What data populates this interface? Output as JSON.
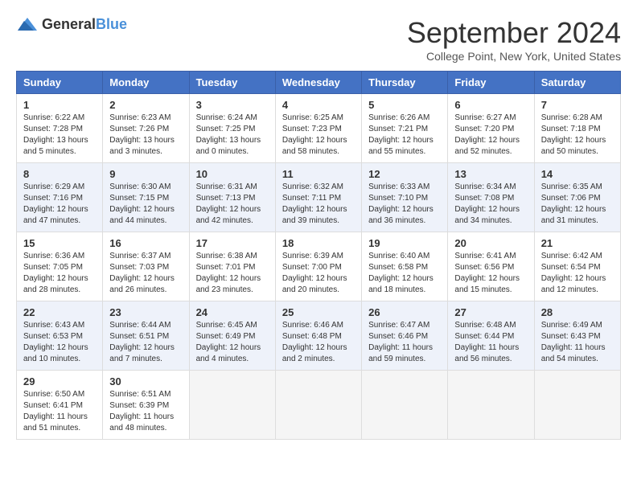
{
  "logo": {
    "general": "General",
    "blue": "Blue"
  },
  "title": "September 2024",
  "location": "College Point, New York, United States",
  "days_of_week": [
    "Sunday",
    "Monday",
    "Tuesday",
    "Wednesday",
    "Thursday",
    "Friday",
    "Saturday"
  ],
  "weeks": [
    [
      {
        "day": "1",
        "sunrise": "6:22 AM",
        "sunset": "7:28 PM",
        "daylight": "13 hours and 5 minutes."
      },
      {
        "day": "2",
        "sunrise": "6:23 AM",
        "sunset": "7:26 PM",
        "daylight": "13 hours and 3 minutes."
      },
      {
        "day": "3",
        "sunrise": "6:24 AM",
        "sunset": "7:25 PM",
        "daylight": "13 hours and 0 minutes."
      },
      {
        "day": "4",
        "sunrise": "6:25 AM",
        "sunset": "7:23 PM",
        "daylight": "12 hours and 58 minutes."
      },
      {
        "day": "5",
        "sunrise": "6:26 AM",
        "sunset": "7:21 PM",
        "daylight": "12 hours and 55 minutes."
      },
      {
        "day": "6",
        "sunrise": "6:27 AM",
        "sunset": "7:20 PM",
        "daylight": "12 hours and 52 minutes."
      },
      {
        "day": "7",
        "sunrise": "6:28 AM",
        "sunset": "7:18 PM",
        "daylight": "12 hours and 50 minutes."
      }
    ],
    [
      {
        "day": "8",
        "sunrise": "6:29 AM",
        "sunset": "7:16 PM",
        "daylight": "12 hours and 47 minutes."
      },
      {
        "day": "9",
        "sunrise": "6:30 AM",
        "sunset": "7:15 PM",
        "daylight": "12 hours and 44 minutes."
      },
      {
        "day": "10",
        "sunrise": "6:31 AM",
        "sunset": "7:13 PM",
        "daylight": "12 hours and 42 minutes."
      },
      {
        "day": "11",
        "sunrise": "6:32 AM",
        "sunset": "7:11 PM",
        "daylight": "12 hours and 39 minutes."
      },
      {
        "day": "12",
        "sunrise": "6:33 AM",
        "sunset": "7:10 PM",
        "daylight": "12 hours and 36 minutes."
      },
      {
        "day": "13",
        "sunrise": "6:34 AM",
        "sunset": "7:08 PM",
        "daylight": "12 hours and 34 minutes."
      },
      {
        "day": "14",
        "sunrise": "6:35 AM",
        "sunset": "7:06 PM",
        "daylight": "12 hours and 31 minutes."
      }
    ],
    [
      {
        "day": "15",
        "sunrise": "6:36 AM",
        "sunset": "7:05 PM",
        "daylight": "12 hours and 28 minutes."
      },
      {
        "day": "16",
        "sunrise": "6:37 AM",
        "sunset": "7:03 PM",
        "daylight": "12 hours and 26 minutes."
      },
      {
        "day": "17",
        "sunrise": "6:38 AM",
        "sunset": "7:01 PM",
        "daylight": "12 hours and 23 minutes."
      },
      {
        "day": "18",
        "sunrise": "6:39 AM",
        "sunset": "7:00 PM",
        "daylight": "12 hours and 20 minutes."
      },
      {
        "day": "19",
        "sunrise": "6:40 AM",
        "sunset": "6:58 PM",
        "daylight": "12 hours and 18 minutes."
      },
      {
        "day": "20",
        "sunrise": "6:41 AM",
        "sunset": "6:56 PM",
        "daylight": "12 hours and 15 minutes."
      },
      {
        "day": "21",
        "sunrise": "6:42 AM",
        "sunset": "6:54 PM",
        "daylight": "12 hours and 12 minutes."
      }
    ],
    [
      {
        "day": "22",
        "sunrise": "6:43 AM",
        "sunset": "6:53 PM",
        "daylight": "12 hours and 10 minutes."
      },
      {
        "day": "23",
        "sunrise": "6:44 AM",
        "sunset": "6:51 PM",
        "daylight": "12 hours and 7 minutes."
      },
      {
        "day": "24",
        "sunrise": "6:45 AM",
        "sunset": "6:49 PM",
        "daylight": "12 hours and 4 minutes."
      },
      {
        "day": "25",
        "sunrise": "6:46 AM",
        "sunset": "6:48 PM",
        "daylight": "12 hours and 2 minutes."
      },
      {
        "day": "26",
        "sunrise": "6:47 AM",
        "sunset": "6:46 PM",
        "daylight": "11 hours and 59 minutes."
      },
      {
        "day": "27",
        "sunrise": "6:48 AM",
        "sunset": "6:44 PM",
        "daylight": "11 hours and 56 minutes."
      },
      {
        "day": "28",
        "sunrise": "6:49 AM",
        "sunset": "6:43 PM",
        "daylight": "11 hours and 54 minutes."
      }
    ],
    [
      {
        "day": "29",
        "sunrise": "6:50 AM",
        "sunset": "6:41 PM",
        "daylight": "11 hours and 51 minutes."
      },
      {
        "day": "30",
        "sunrise": "6:51 AM",
        "sunset": "6:39 PM",
        "daylight": "11 hours and 48 minutes."
      },
      null,
      null,
      null,
      null,
      null
    ]
  ],
  "labels": {
    "sunrise": "Sunrise:",
    "sunset": "Sunset:",
    "daylight": "Daylight:"
  }
}
